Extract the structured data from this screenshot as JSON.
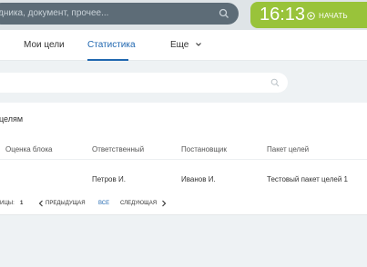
{
  "header": {
    "search_placeholder": "дника, документ, прочее...",
    "time": "16:13",
    "start_label": "НАЧАТЬ"
  },
  "nav": {
    "my_goals": "Мои цели",
    "statistics": "Статистика",
    "more": "Еще"
  },
  "section": {
    "title": "целям"
  },
  "table": {
    "columns": [
      "Оценка блока",
      "Ответственный",
      "Постановщик",
      "Пакет целей"
    ],
    "rows": [
      [
        "",
        "Петров И.",
        "Иванов И.",
        "Тестовый пакет целей 1"
      ]
    ]
  },
  "pager": {
    "page_label": "ИЦЫ:",
    "page_value": "1",
    "prev": "ПРЕДЫДУЩАЯ",
    "all": "ВСЕ",
    "next": "СЛЕДУЮЩАЯ"
  }
}
